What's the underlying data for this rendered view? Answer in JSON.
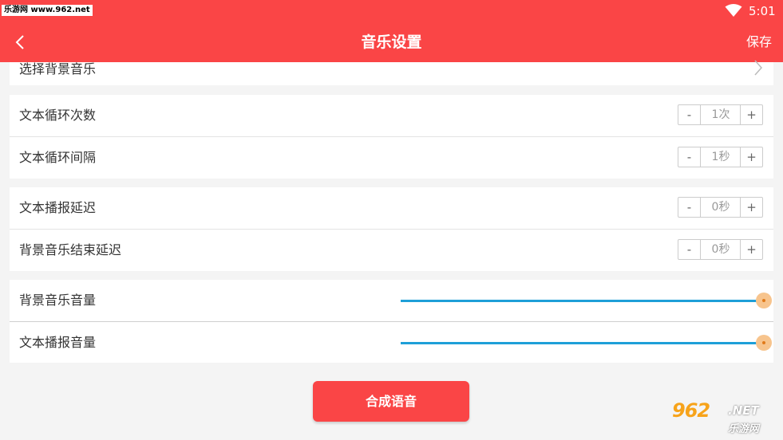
{
  "status_bar": {
    "watermark": "乐游网 www.962.net",
    "time": "5:01"
  },
  "header": {
    "title": "音乐设置",
    "save_label": "保存",
    "back_icon": "chevron-left-icon"
  },
  "background_music": {
    "label": "选择背景音乐"
  },
  "loop_settings": {
    "loop_count": {
      "label": "文本循环次数",
      "minus": "-",
      "value": "1次",
      "plus": "+"
    },
    "loop_interval": {
      "label": "文本循环间隔",
      "minus": "-",
      "value": "1秒",
      "plus": "+"
    }
  },
  "delay_settings": {
    "broadcast_delay": {
      "label": "文本播报延迟",
      "minus": "-",
      "value": "0秒",
      "plus": "+"
    },
    "music_end_delay": {
      "label": "背景音乐结束延迟",
      "minus": "-",
      "value": "0秒",
      "plus": "+"
    }
  },
  "volume_settings": {
    "music_volume": {
      "label": "背景音乐音量",
      "level": 1.0
    },
    "speech_volume": {
      "label": "文本播报音量",
      "level": 1.0
    }
  },
  "action": {
    "label": "合成语音"
  },
  "watermark_logo": {
    "big": "962",
    "net": ".NET",
    "cn": "乐游网"
  },
  "colors": {
    "header": "#fa4546",
    "slider_track": "#1e9fd8",
    "slider_thumb": "#f7c48d",
    "button": "#fa4546"
  }
}
